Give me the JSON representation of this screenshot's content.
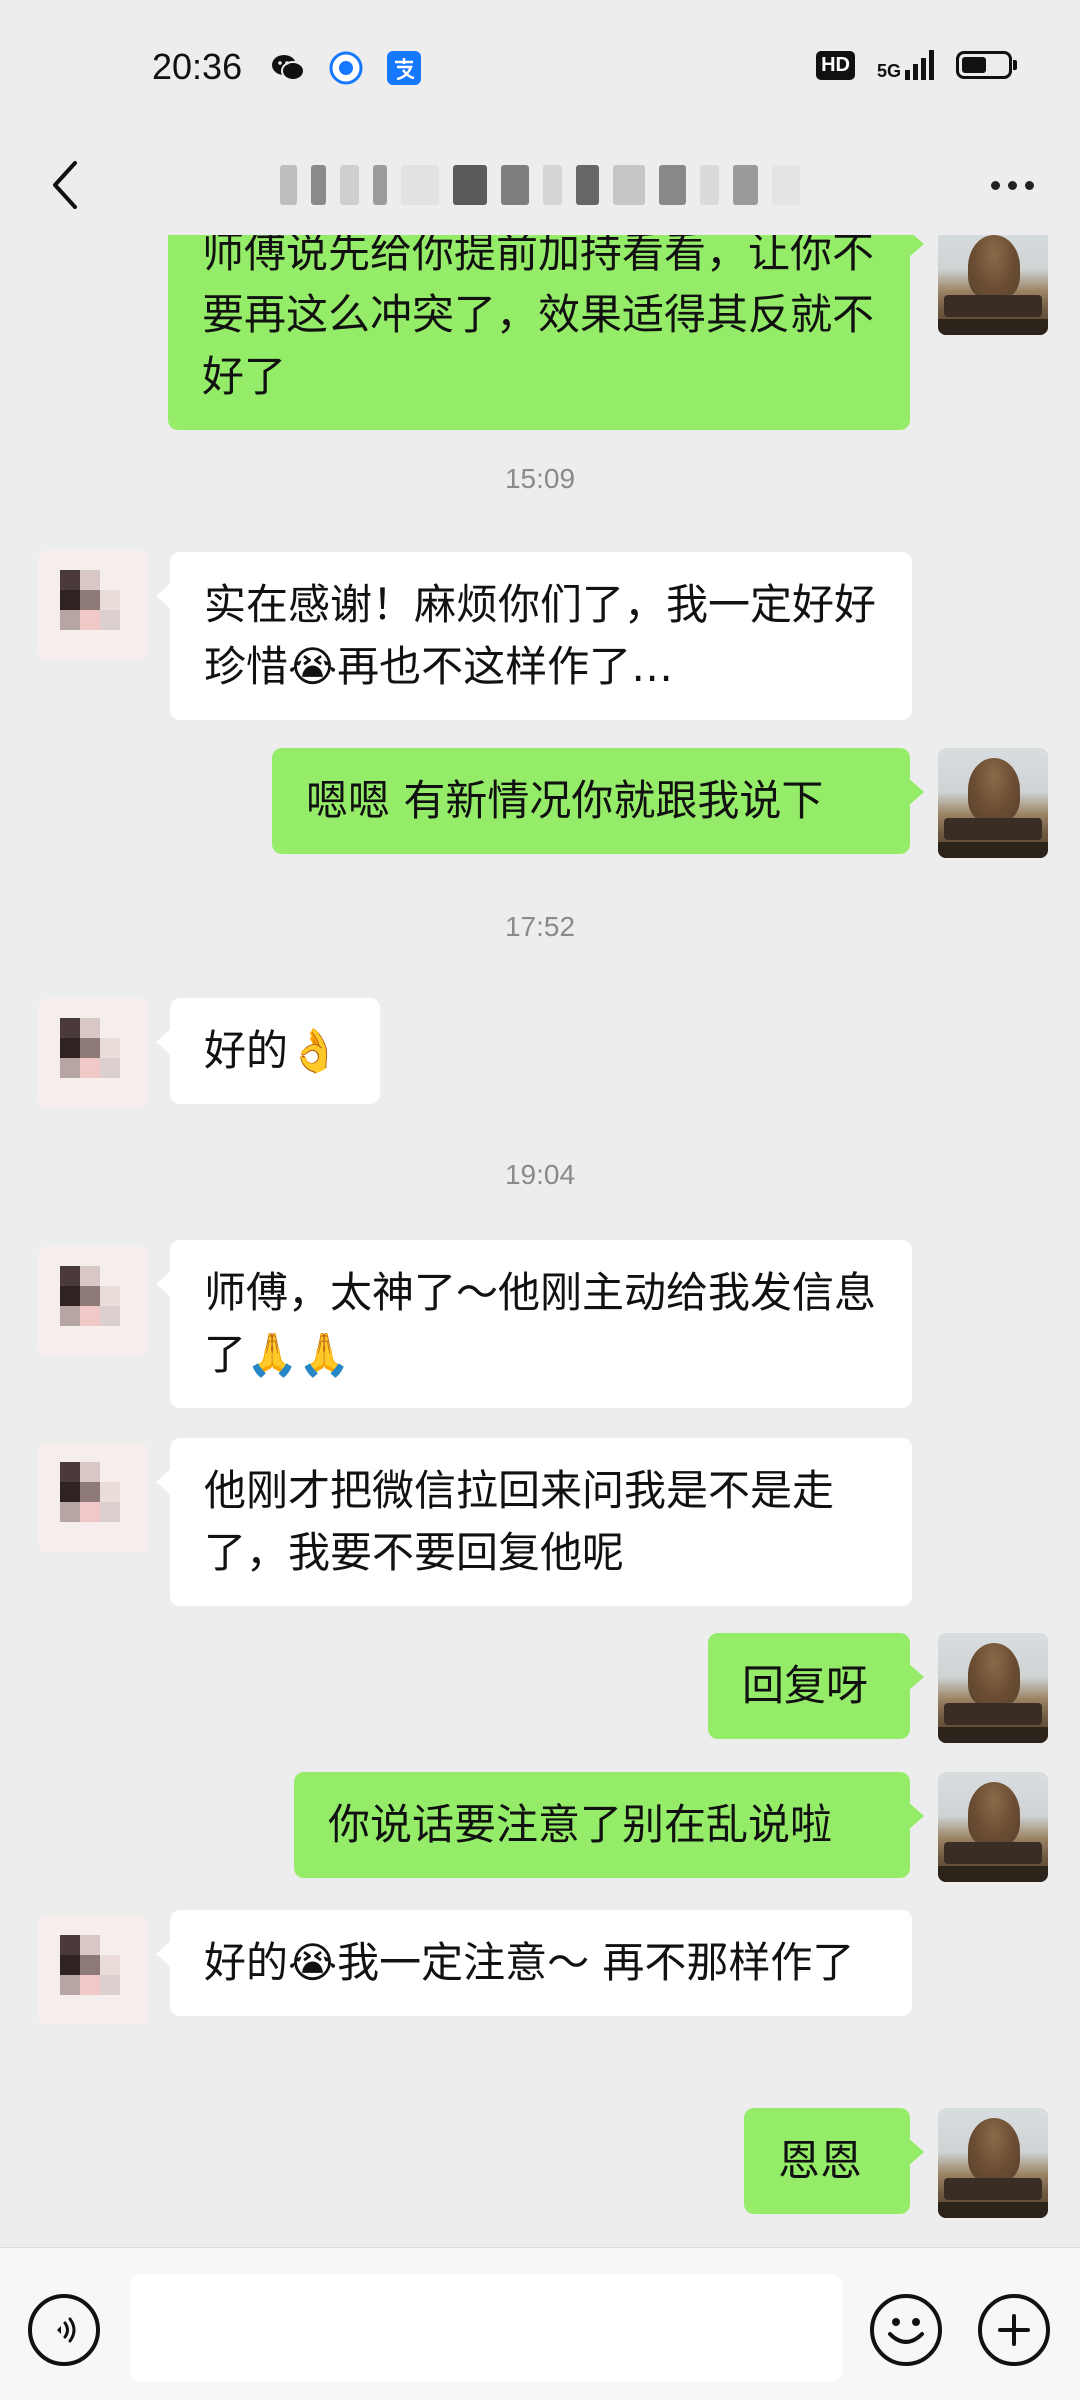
{
  "status_bar": {
    "time": "20:36",
    "left_icons": [
      "wechat-icon",
      "target-icon",
      "alipay-icon"
    ],
    "hd": "HD",
    "network": "5G",
    "battery_level": 0.55
  },
  "nav": {
    "back_icon": "chevron-left-icon",
    "title": "",
    "more_icon": "more-dots-icon"
  },
  "messages": [
    {
      "type": "out",
      "text": "师傅说先给你提前加持看看，让你不要再这么冲突了，效果适得其反就不好了"
    },
    {
      "type": "timestamp",
      "text": "15:09"
    },
    {
      "type": "in",
      "text": "实在感谢！麻烦你们了，我一定好好珍惜😭再也不这样作了…"
    },
    {
      "type": "out",
      "text": "嗯嗯  有新情况你就跟我说下"
    },
    {
      "type": "timestamp",
      "text": "17:52"
    },
    {
      "type": "in",
      "text": "好的👌"
    },
    {
      "type": "timestamp",
      "text": "19:04"
    },
    {
      "type": "in",
      "text": "师傅，太神了～他刚主动给我发信息了🙏🙏"
    },
    {
      "type": "in",
      "text": "他刚才把微信拉回来问我是不是走了，我要不要回复他呢"
    },
    {
      "type": "out",
      "text": "回复呀"
    },
    {
      "type": "out",
      "text": "你说话要注意了别在乱说啦"
    },
    {
      "type": "in",
      "text": "好的😭我一定注意～ 再不那样作了"
    },
    {
      "type": "out",
      "text": "恩恩"
    }
  ],
  "input_bar": {
    "voice_icon": "voice-icon",
    "text_value": "",
    "emoji_icon": "emoji-icon",
    "plus_icon": "plus-icon"
  },
  "colors": {
    "background": "#ededed",
    "outgoing_bubble": "#95ec69",
    "incoming_bubble": "#ffffff",
    "timestamp": "#8a8a8a"
  }
}
